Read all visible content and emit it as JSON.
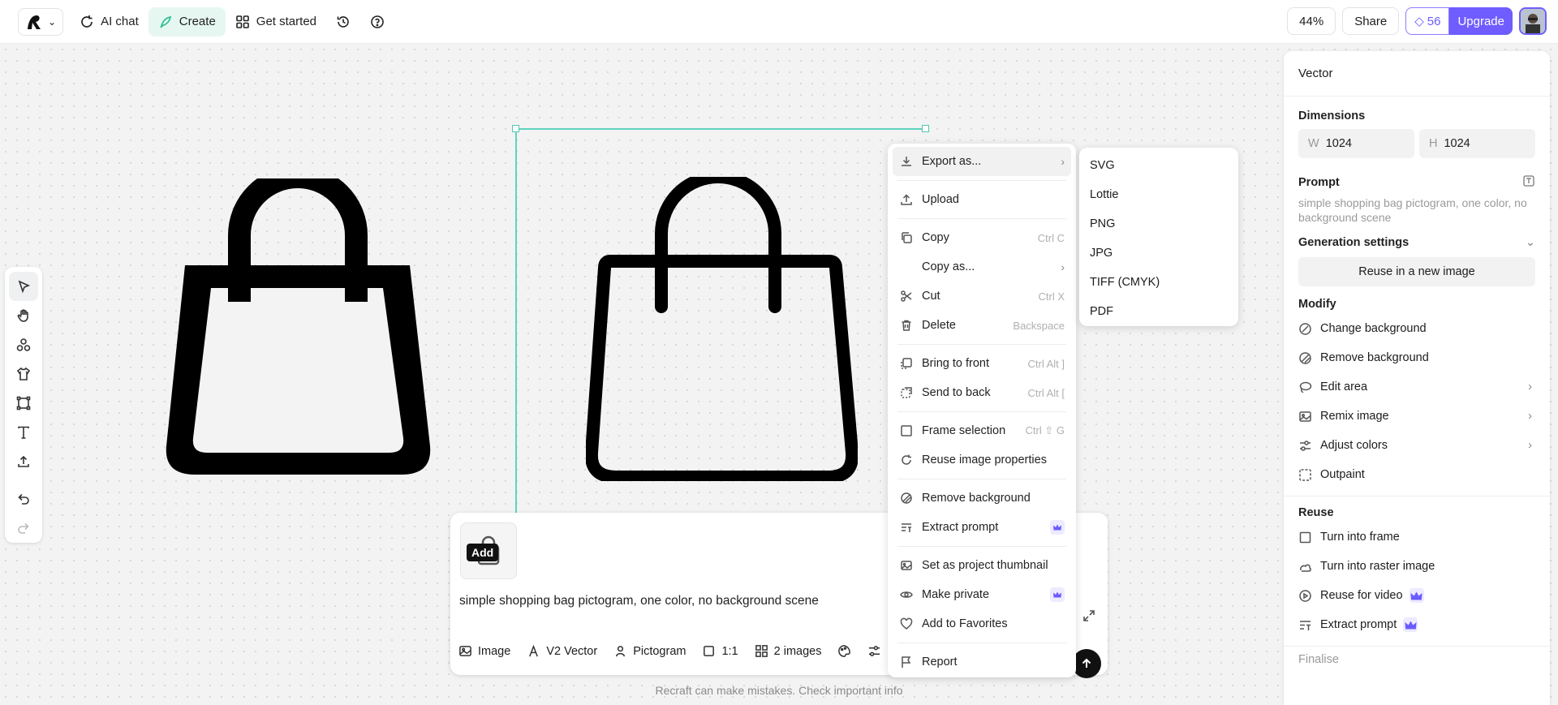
{
  "topbar": {
    "ai_chat": "AI chat",
    "create": "Create",
    "get_started": "Get started",
    "zoom": "44%",
    "share": "Share",
    "credits": "56",
    "upgrade": "Upgrade"
  },
  "prompt": {
    "thumb_label": "Add",
    "text": "simple shopping bag pictogram, one color, no background scene",
    "options": {
      "type": "Image",
      "model": "V2 Vector",
      "style": "Pictogram",
      "ratio": "1:1",
      "count": "2 images"
    },
    "disclaimer": "Recraft can make mistakes. Check important info"
  },
  "context_menu": {
    "export_as": "Export as...",
    "upload": "Upload",
    "copy": "Copy",
    "copy_sc": "Ctrl C",
    "copy_as": "Copy as...",
    "cut": "Cut",
    "cut_sc": "Ctrl X",
    "delete": "Delete",
    "delete_sc": "Backspace",
    "bring_front": "Bring to front",
    "bring_front_sc": "Ctrl Alt ]",
    "send_back": "Send to back",
    "send_back_sc": "Ctrl Alt [",
    "frame_selection": "Frame selection",
    "frame_selection_sc": "Ctrl ⇧ G",
    "reuse_props": "Reuse image properties",
    "remove_bg": "Remove background",
    "extract_prompt": "Extract prompt",
    "set_thumb": "Set as project thumbnail",
    "make_private": "Make private",
    "add_fav": "Add to Favorites",
    "report": "Report"
  },
  "export_submenu": [
    "SVG",
    "Lottie",
    "PNG",
    "JPG",
    "TIFF (CMYK)",
    "PDF"
  ],
  "panel": {
    "title": "Vector",
    "dimensions": "Dimensions",
    "w_label": "W",
    "w": "1024",
    "h_label": "H",
    "h": "1024",
    "prompt_title": "Prompt",
    "prompt_text": "simple shopping bag pictogram, one color, no background scene",
    "gen_settings": "Generation settings",
    "reuse_btn": "Reuse in a new image",
    "modify": "Modify",
    "change_bg": "Change background",
    "remove_bg": "Remove background",
    "edit_area": "Edit area",
    "remix": "Remix image",
    "adjust_colors": "Adjust colors",
    "outpaint": "Outpaint",
    "reuse": "Reuse",
    "turn_frame": "Turn into frame",
    "turn_raster": "Turn into raster image",
    "reuse_video": "Reuse for video",
    "extract_prompt": "Extract prompt",
    "finalise": "Finalise"
  }
}
